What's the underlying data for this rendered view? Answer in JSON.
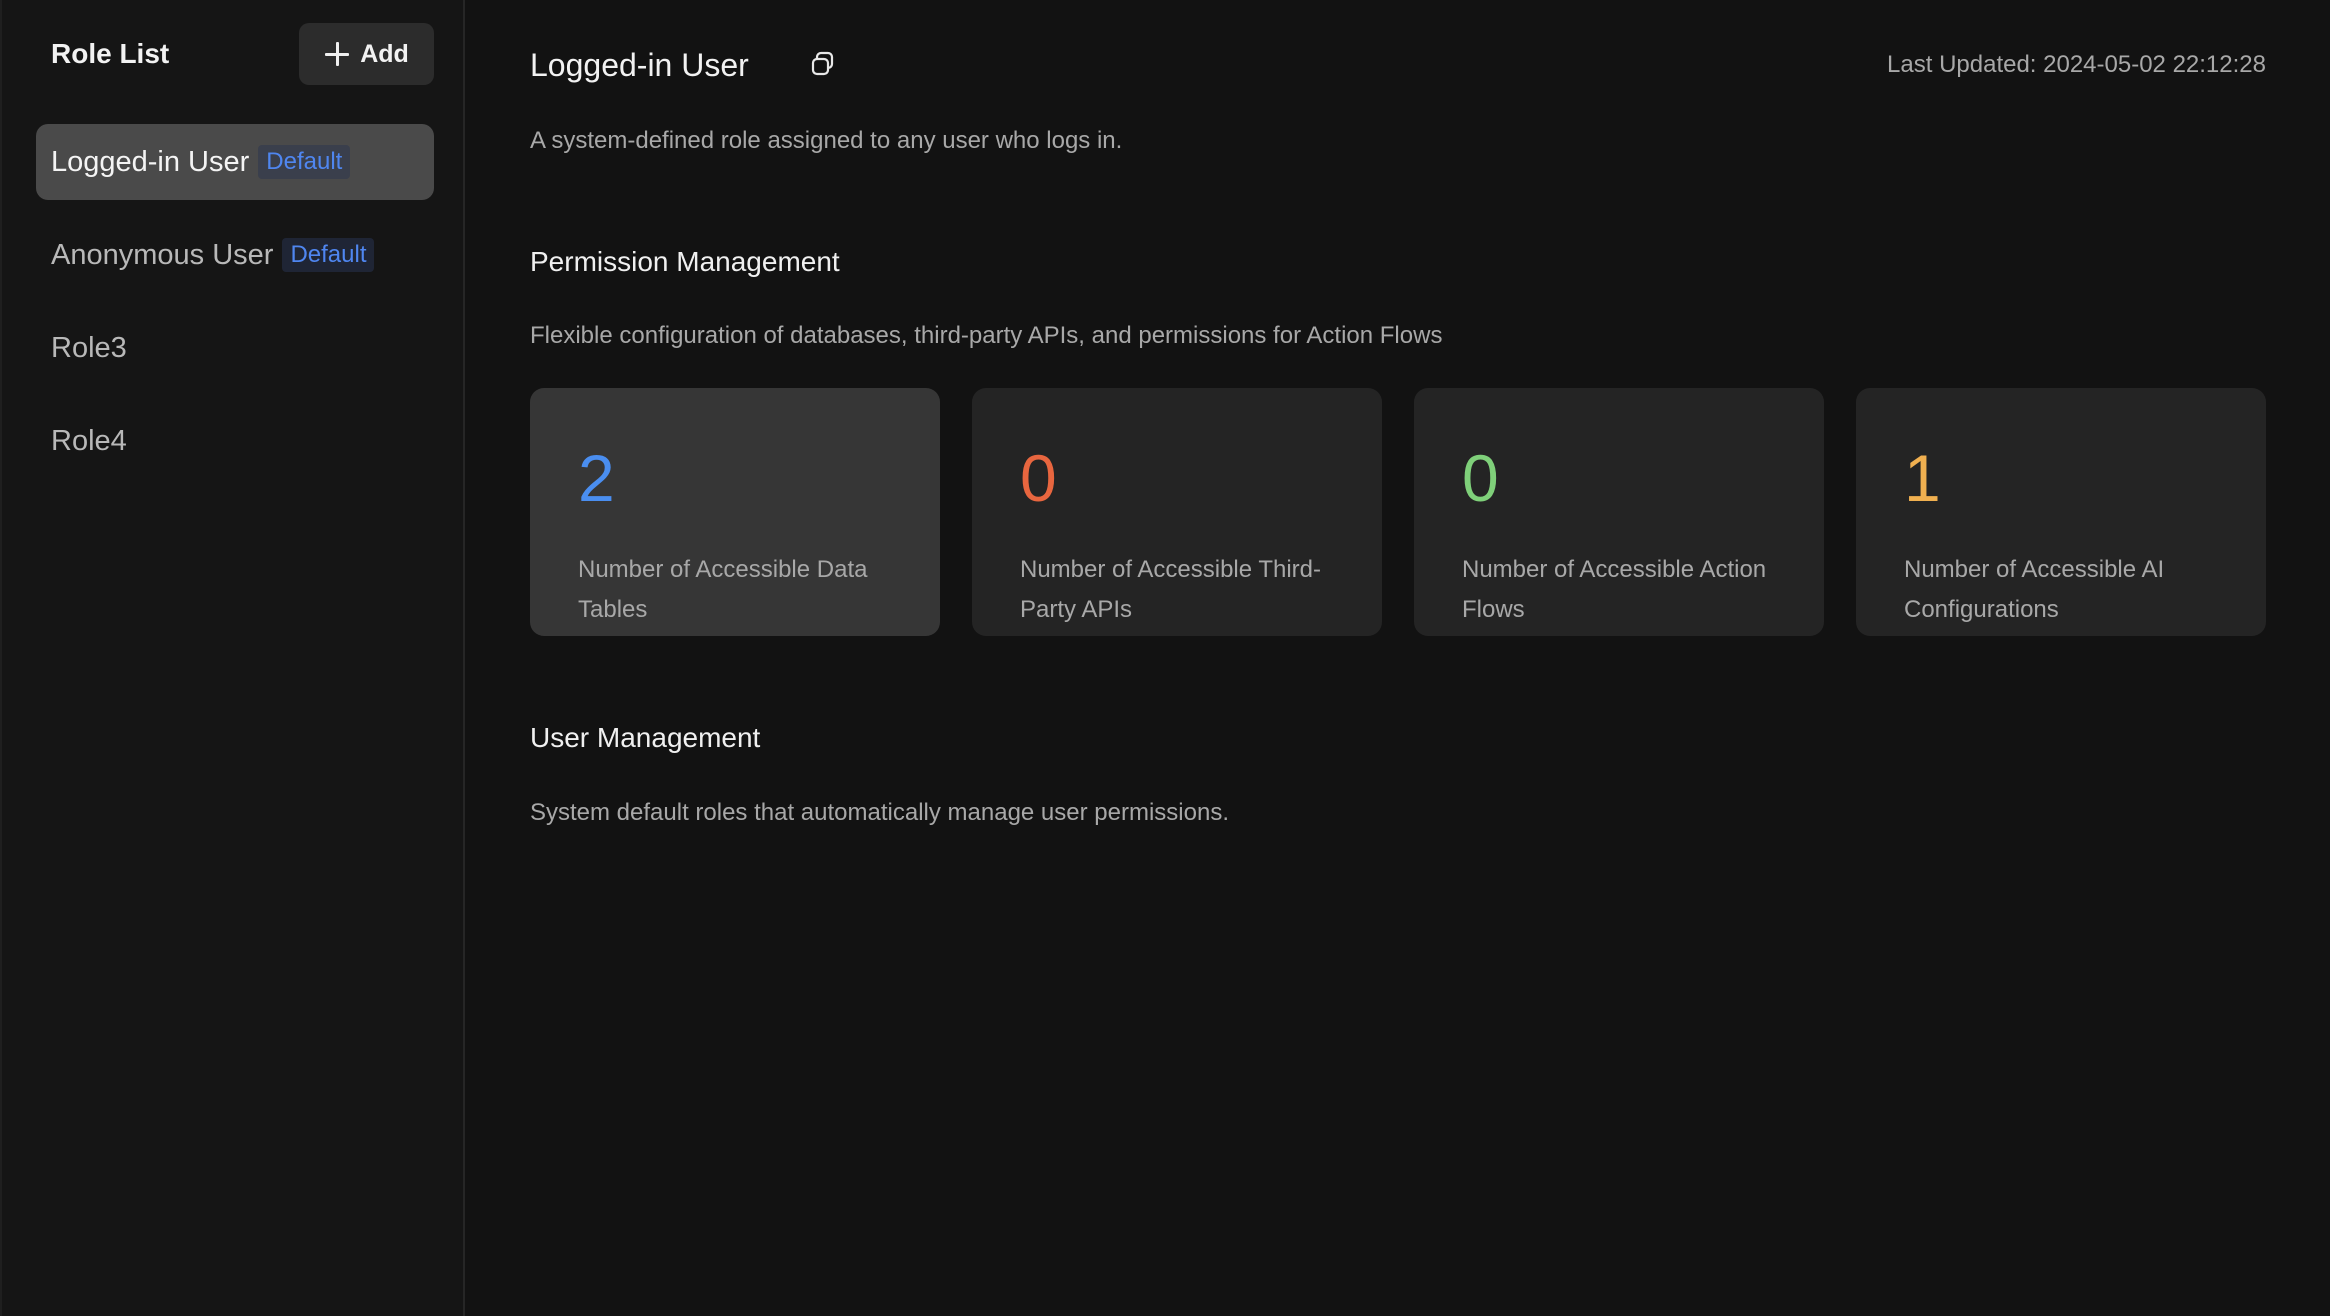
{
  "sidebar": {
    "title": "Role List",
    "add_label": "Add",
    "roles": [
      {
        "name": "Logged-in User",
        "badge": "Default",
        "active": true
      },
      {
        "name": "Anonymous User",
        "badge": "Default",
        "active": false
      },
      {
        "name": "Role3",
        "badge": "",
        "active": false
      },
      {
        "name": "Role4",
        "badge": "",
        "active": false
      }
    ]
  },
  "main": {
    "title": "Logged-in User",
    "copy_icon": "copy-icon",
    "last_updated": "Last Updated: 2024-05-02 22:12:28",
    "description": "A system-defined role assigned to any user who logs in.",
    "permission": {
      "title": "Permission Management",
      "description": "Flexible configuration of databases, third-party APIs, and permissions for Action Flows",
      "cards": [
        {
          "value": "2",
          "label": "Number of Accessible Data Tables",
          "color": "#4a8ef0"
        },
        {
          "value": "0",
          "label": "Number of Accessible Third-Party APIs",
          "color": "#e8663f"
        },
        {
          "value": "0",
          "label": "Number of Accessible Action Flows",
          "color": "#7fd07a"
        },
        {
          "value": "1",
          "label": "Number of Accessible AI Configurations",
          "color": "#f0b050"
        }
      ]
    },
    "user_management": {
      "title": "User Management",
      "description": "System default roles that automatically manage user permissions."
    }
  }
}
